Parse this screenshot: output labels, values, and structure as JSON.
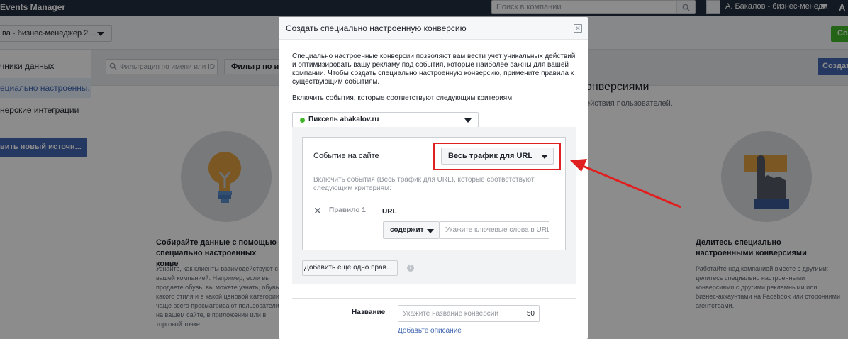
{
  "app": {
    "title": "Events Manager"
  },
  "topbar": {
    "search_placeholder": "Поиск в компании",
    "account_name": "А. Бакалов - бизнес-менедж",
    "notification_glyph": "A"
  },
  "subbar": {
    "business_selector": "ва - бизнес-менеджер 2....",
    "green_button": "Созд"
  },
  "sidebar": {
    "items": [
      {
        "label": "чники данных"
      },
      {
        "label": "ециально настроенны..."
      },
      {
        "label": "нерские интеграции"
      }
    ],
    "add_source_button": "вить новый источн..."
  },
  "content": {
    "filter_placeholder": "Фильтрация по имени или ID",
    "filter_button": "Фильтр по ист",
    "create_button": "Создат",
    "right_heading": "онверсиями",
    "right_subheading": "ействия пользователей.",
    "col1_title": "Собирайте данные с помощью специально настроенных конве",
    "col1_text": "Узнайте, как клиенты взаимодействуют с вашей компанией. Например, если вы продаете обувь, вы можете узнать, обувь какого стиля и в какой ценовой категории чаще всего просматривают пользователи на вашем сайте, в приложении или в торговой точке.",
    "col3_title": "Делитесь специально настроенными конверсиями",
    "col3_text": "Работайте над кампанией вместе с другими: делитесь специально настроенными конверсиями с другими рекламными или бизнес-аккаунтами на Facebook или сторонними агентствами."
  },
  "modal": {
    "title": "Создать специально настроенную конверсию",
    "close_glyph": "✕",
    "intro": "Специально настроенные конверсии позволяют вам вести учет уникальных действий и оптимизировать вашу рекламу под события, которые наиболее важны для вашей компании. Чтобы создать специально настроенную конверсию, примените правила к существующим событиям.",
    "criteria_label": "Включить события, которые соответствуют следующим критериям",
    "pixel": {
      "label": "Пиксель abakalov.ru",
      "status_color": "#42b72a"
    },
    "event": {
      "label": "Событие на сайте",
      "selected": "Весь трафик для URL",
      "description": "Включить события (Весь трафик для URL), которые соответствуют следующим критериям:"
    },
    "rule": {
      "remove_glyph": "✕",
      "label": "Правило 1",
      "field": "URL",
      "operator": "содержит",
      "keywords_placeholder": "Укажите ключевые слова в URL"
    },
    "add_rule_button": "Добавить ещё одно прав...",
    "info_glyph": "i",
    "name": {
      "label": "Название",
      "placeholder": "Укажите название конверсии",
      "counter": "50"
    },
    "add_description_link": "Добавьте описание"
  },
  "colors": {
    "topbar": "#232f3e",
    "primary": "#4267b2",
    "green": "#42b72a",
    "annotation_red": "#e02020"
  }
}
